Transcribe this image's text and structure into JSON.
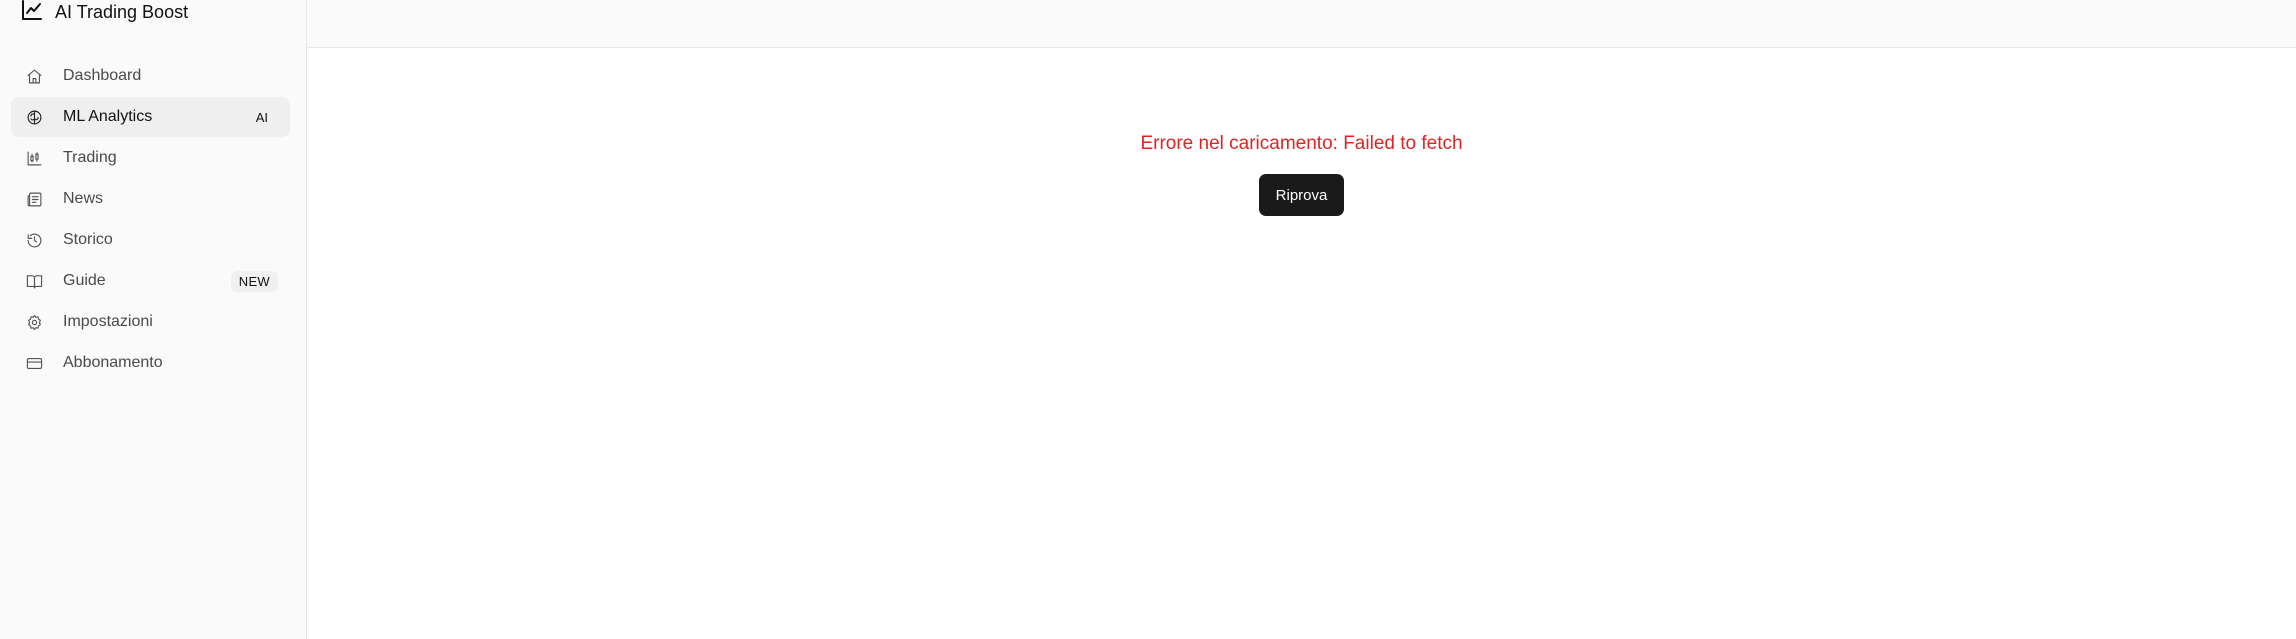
{
  "brand": {
    "title": "AI Trading Boost",
    "icon": "trend-line-icon"
  },
  "sidebar": {
    "items": [
      {
        "label": "Dashboard",
        "icon": "home-icon",
        "active": false,
        "badge": ""
      },
      {
        "label": "ML Analytics",
        "icon": "brain-icon",
        "active": true,
        "badge": "AI"
      },
      {
        "label": "Trading",
        "icon": "candlestick-icon",
        "active": false,
        "badge": ""
      },
      {
        "label": "News",
        "icon": "newspaper-icon",
        "active": false,
        "badge": ""
      },
      {
        "label": "Storico",
        "icon": "history-icon",
        "active": false,
        "badge": ""
      },
      {
        "label": "Guide",
        "icon": "book-icon",
        "active": false,
        "badge": "NEW"
      },
      {
        "label": "Impostazioni",
        "icon": "gear-icon",
        "active": false,
        "badge": ""
      },
      {
        "label": "Abbonamento",
        "icon": "credit-card-icon",
        "active": false,
        "badge": ""
      }
    ]
  },
  "main": {
    "error_message": "Errore nel caricamento: Failed to fetch",
    "retry_label": "Riprova"
  },
  "colors": {
    "error": "#e02424",
    "button_bg": "#1a1a1a",
    "sidebar_bg": "#fafafa",
    "active_item_bg": "#efefef"
  }
}
